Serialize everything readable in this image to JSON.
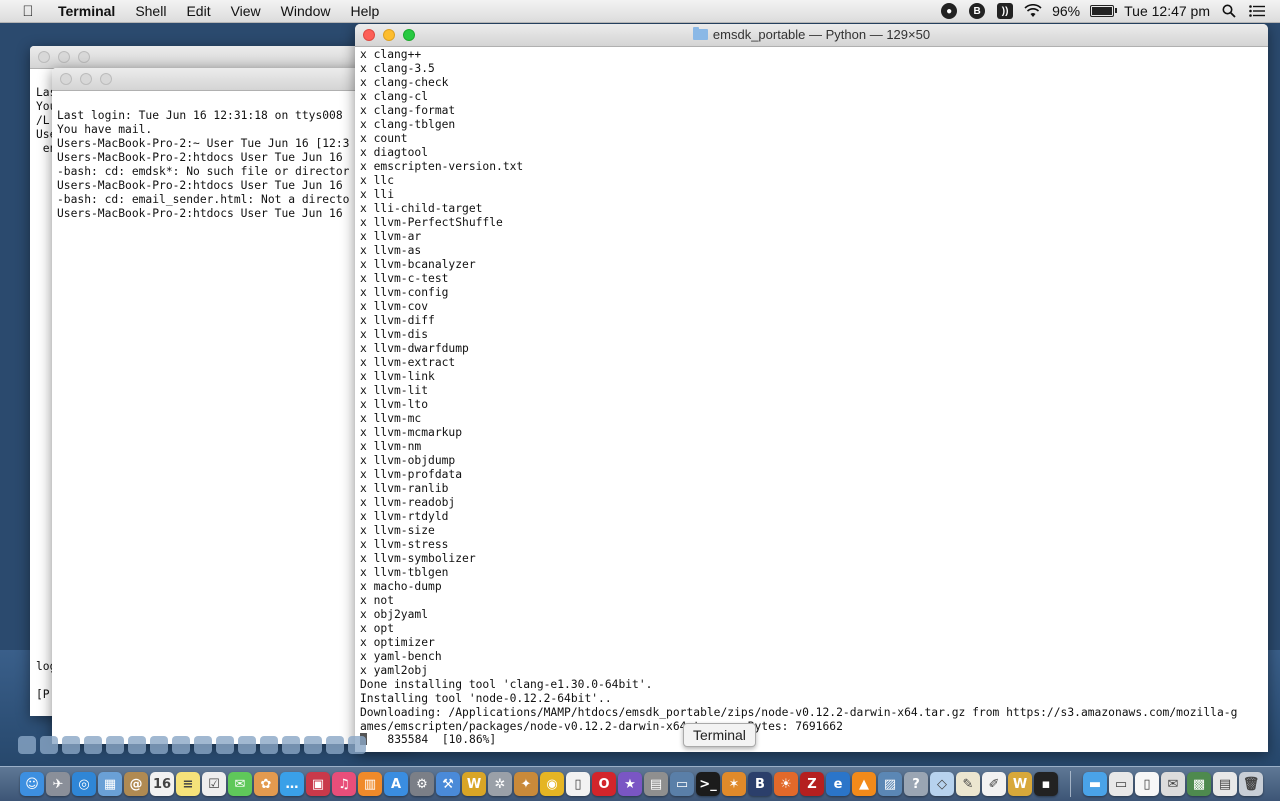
{
  "menubar": {
    "app_name": "Terminal",
    "menus": [
      "Shell",
      "Edit",
      "View",
      "Window",
      "Help"
    ],
    "battery": "96%",
    "clock": "Tue 12:47 pm"
  },
  "back_window": {
    "lines": [
      "Las",
      "You",
      "/L",
      "Use",
      " en",
      "log",
      "[P"
    ]
  },
  "mid_window": {
    "lines": [
      "Last login: Tue Jun 16 12:31:18 on ttys008",
      "You have mail.",
      "Users-MacBook-Pro-2:~ User Tue Jun 16 [12:3",
      "Users-MacBook-Pro-2:htdocs User Tue Jun 16",
      "-bash: cd: emdsk*: No such file or director",
      "Users-MacBook-Pro-2:htdocs User Tue Jun 16",
      "-bash: cd: email_sender.html: Not a directo",
      "Users-MacBook-Pro-2:htdocs User Tue Jun 16"
    ]
  },
  "main_window": {
    "title": "emsdk_portable — Python — 129×50",
    "lines": [
      "x clang++",
      "x clang-3.5",
      "x clang-check",
      "x clang-cl",
      "x clang-format",
      "x clang-tblgen",
      "x count",
      "x diagtool",
      "x emscripten-version.txt",
      "x llc",
      "x lli",
      "x lli-child-target",
      "x llvm-PerfectShuffle",
      "x llvm-ar",
      "x llvm-as",
      "x llvm-bcanalyzer",
      "x llvm-c-test",
      "x llvm-config",
      "x llvm-cov",
      "x llvm-diff",
      "x llvm-dis",
      "x llvm-dwarfdump",
      "x llvm-extract",
      "x llvm-link",
      "x llvm-lit",
      "x llvm-lto",
      "x llvm-mc",
      "x llvm-mcmarkup",
      "x llvm-nm",
      "x llvm-objdump",
      "x llvm-profdata",
      "x llvm-ranlib",
      "x llvm-readobj",
      "x llvm-rtdyld",
      "x llvm-size",
      "x llvm-stress",
      "x llvm-symbolizer",
      "x llvm-tblgen",
      "x macho-dump",
      "x not",
      "x obj2yaml",
      "x opt",
      "x optimizer",
      "x yaml-bench",
      "x yaml2obj",
      "Done installing tool 'clang-e1.30.0-64bit'.",
      "Installing tool 'node-0.12.2-64bit'..",
      "Downloading: /Applications/MAMP/htdocs/emsdk_portable/zips/node-v0.12.2-darwin-x64.tar.gz from https://s3.amazonaws.com/mozilla-g",
      "ames/emscripten/packages/node-v0.12.2-darwin-x64.tar.gz, Bytes: 7691662"
    ],
    "progress_line": "   835584  [10.86%]"
  },
  "tooltip": "Terminal",
  "dock": {
    "icons": [
      {
        "name": "finder-icon",
        "color": "#3d8fe0",
        "glyph": "☺"
      },
      {
        "name": "launchpad-icon",
        "color": "#8a8f99",
        "glyph": "✈"
      },
      {
        "name": "safari-icon",
        "color": "#2f86d6",
        "glyph": "◎"
      },
      {
        "name": "preview-icon",
        "color": "#6aa0d6",
        "glyph": "▦"
      },
      {
        "name": "contacts-icon",
        "color": "#b08a52",
        "glyph": "@"
      },
      {
        "name": "calendar-icon",
        "color": "#f2f2f2",
        "glyph": "16"
      },
      {
        "name": "notes-icon",
        "color": "#f5e27a",
        "glyph": "≡"
      },
      {
        "name": "reminders-icon",
        "color": "#eeeeee",
        "glyph": "☑"
      },
      {
        "name": "messages-icon",
        "color": "#5fc85a",
        "glyph": "✉"
      },
      {
        "name": "photos-icon",
        "color": "#e39a4f",
        "glyph": "✿"
      },
      {
        "name": "chat-icon",
        "color": "#3aa0e8",
        "glyph": "…"
      },
      {
        "name": "photo-booth-icon",
        "color": "#c9394a",
        "glyph": "▣"
      },
      {
        "name": "itunes-icon",
        "color": "#e84e7a",
        "glyph": "♫"
      },
      {
        "name": "ibooks-icon",
        "color": "#f08a2a",
        "glyph": "▥"
      },
      {
        "name": "app-store-icon",
        "color": "#3a8de0",
        "glyph": "A"
      },
      {
        "name": "system-preferences-icon",
        "color": "#7b7f87",
        "glyph": "⚙"
      },
      {
        "name": "xcode-icon",
        "color": "#4a8ad8",
        "glyph": "⚒"
      },
      {
        "name": "word-icon",
        "color": "#d9a526",
        "glyph": "W"
      },
      {
        "name": "utility-icon",
        "color": "#9aa0a8",
        "glyph": "✲"
      },
      {
        "name": "tool-icon",
        "color": "#c98a3a",
        "glyph": "✦"
      },
      {
        "name": "chrome-icon",
        "color": "#e5b524",
        "glyph": "◉"
      },
      {
        "name": "document-icon",
        "color": "#f2f2f2",
        "glyph": "▯"
      },
      {
        "name": "opera-icon",
        "color": "#d3252b",
        "glyph": "O"
      },
      {
        "name": "imovie-icon",
        "color": "#7a56c4",
        "glyph": "★"
      },
      {
        "name": "archive-icon",
        "color": "#8f8f8f",
        "glyph": "▤"
      },
      {
        "name": "scanner-icon",
        "color": "#5a7fa8",
        "glyph": "▭"
      },
      {
        "name": "terminal-icon",
        "color": "#1b1b1b",
        "glyph": ">_"
      },
      {
        "name": "java-icon",
        "color": "#e08a2a",
        "glyph": "✶"
      },
      {
        "name": "bbedit-icon",
        "color": "#2b3f6b",
        "glyph": "B"
      },
      {
        "name": "firefox-icon",
        "color": "#e2692a",
        "glyph": "☀"
      },
      {
        "name": "filezilla-icon",
        "color": "#b52020",
        "glyph": "Z"
      },
      {
        "name": "ie-icon",
        "color": "#2b75c9",
        "glyph": "e"
      },
      {
        "name": "vlc-icon",
        "color": "#f28a1a",
        "glyph": "▲"
      },
      {
        "name": "screen-icon",
        "color": "#5b87b5",
        "glyph": "▨"
      },
      {
        "name": "help-icon",
        "color": "#9aa5b3",
        "glyph": "?"
      },
      {
        "name": "box-icon",
        "color": "#b7d2ee",
        "glyph": "◇"
      },
      {
        "name": "script-icon",
        "color": "#ece6d0",
        "glyph": "✎"
      },
      {
        "name": "pages-icon",
        "color": "#f2f2f2",
        "glyph": "✐"
      },
      {
        "name": "wrench-icon",
        "color": "#d8a83a",
        "glyph": "W"
      },
      {
        "name": "terminal2-icon",
        "color": "#222222",
        "glyph": "▪"
      },
      {
        "name": "folder-icon",
        "color": "#4aa3e8",
        "glyph": "▬"
      },
      {
        "name": "stack-icon",
        "color": "#e8e8e8",
        "glyph": "▭"
      },
      {
        "name": "document2-icon",
        "color": "#f7f7f7",
        "glyph": "▯"
      },
      {
        "name": "mail-stack-icon",
        "color": "#dcdcdc",
        "glyph": "✉"
      },
      {
        "name": "photo-stack-icon",
        "color": "#4e8a4e",
        "glyph": "▩"
      },
      {
        "name": "documents-stack-icon",
        "color": "#e8e8e8",
        "glyph": "▤"
      },
      {
        "name": "trash-icon",
        "color": "#c8ced6",
        "glyph": "🗑"
      }
    ]
  }
}
